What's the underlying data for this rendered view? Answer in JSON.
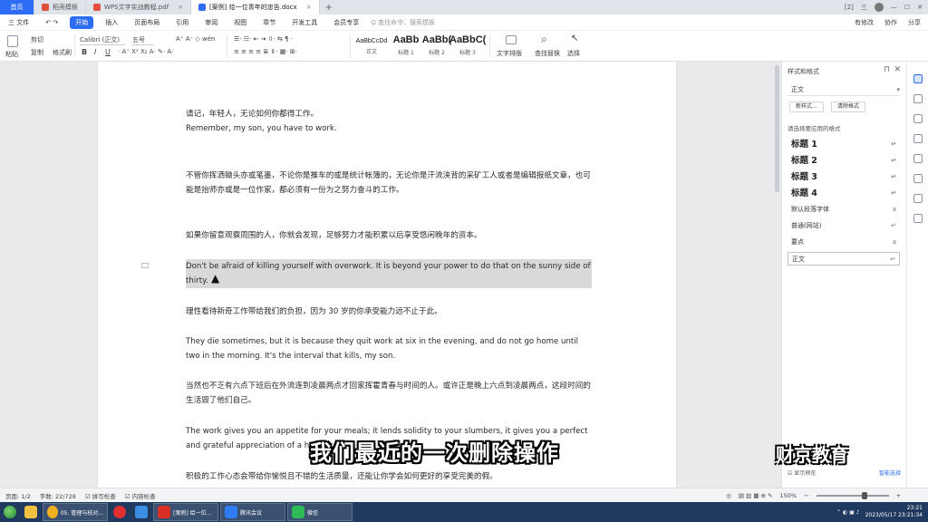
{
  "tabs": [
    {
      "label": "首页",
      "kind": "home"
    },
    {
      "label": "稻壳模板",
      "color": "#e0503c"
    },
    {
      "label": "WPS文字实战教程.pdf",
      "color": "#e0503c",
      "close": "×"
    },
    {
      "label": "[案例] 给一位青年的忠告.docx",
      "color": "#2d6df6",
      "close": "×",
      "active": true
    }
  ],
  "tab_plus": "+",
  "tab_right": {
    "num": "2",
    "badge": "三"
  },
  "menu": {
    "file": "三 文件",
    "items": [
      "开始",
      "插入",
      "页面布局",
      "引用",
      "审阅",
      "视图",
      "章节",
      "开发工具",
      "会员专享"
    ],
    "active": "开始",
    "search": "Q 查找命令、搜索模板",
    "right": [
      "有修改",
      "协作",
      "分享"
    ]
  },
  "ribbon": {
    "paste": "粘贴",
    "cut": "剪切",
    "copy": "复制",
    "format_painter": "格式刷",
    "font": "Calibri (正文)",
    "font_size": "五号",
    "bold": "B",
    "italic": "I",
    "underline": "U",
    "styles": [
      {
        "preview": "AaBbCcDd",
        "label": "正文"
      },
      {
        "preview": "AaBb",
        "label": "标题 1"
      },
      {
        "preview": "AaBb(",
        "label": "标题 2"
      },
      {
        "preview": "AaBbC(",
        "label": "标题 3"
      }
    ],
    "text_layout": "文字排版",
    "find_replace": "查找替换",
    "select": "选择"
  },
  "document": {
    "paragraphs": [
      "请记，年轻人，无论如何你都得工作。\nRemember, my son, you have to work.",
      "不管你挥洒锄头亦或笔墨，不论你是推车的或是统计帐簿的，无论你是汗流浃背的采矿工人或者是编辑报纸文章，也可能是抬师亦或是一位作家，都必须有一份为之努力奋斗的工作。",
      "如果你留意观察周围的人，你就会发现，足够努力才能积累以后享受悠闲晚年的资本。",
      "Don't be afraid of killing yourself with overwork. It is beyond your power to do that on the sunny side of thirty.",
      "理性看待新奇工作带给我们的负担，因为 30 岁的你承受能力远不止于此。",
      "They die sometimes, but it is because they quit work at six in the evening, and do not go home until two in the morning. It's the interval that kills, my son.",
      "当然也不乏有六点下班后在外流连到凌晨两点才回家挥霍青春与时间的人。或许正是晚上六点到凌晨两点，这段时间的生活毁了他们自己。",
      "The work gives you an appetite for your meals; it lends solidity to your slumbers, it gives you a perfect and grateful appreciation of a holiday.",
      "积极的工作心态会带给你愉悦且不错的生活质量，还能让你学会如何更好的享受完美的假。"
    ]
  },
  "panel": {
    "title": "样式和格式",
    "current_style": "正文",
    "new_style": "新样式...",
    "clear_format": "清除格式",
    "apply_label": "请选择要应用的格式",
    "styles": [
      {
        "label": "标题 1",
        "heading": true
      },
      {
        "label": "标题 2",
        "heading": true
      },
      {
        "label": "标题 3",
        "heading": true
      },
      {
        "label": "标题 4",
        "heading": true
      },
      {
        "label": "默认段落字体",
        "heading": false
      },
      {
        "label": "普通(网站)",
        "heading": false
      },
      {
        "label": "要点",
        "heading": false
      },
      {
        "label": "正文",
        "heading": false,
        "selected": true
      }
    ],
    "show_preview": "显示预览",
    "smart_select": "智能选择"
  },
  "status": {
    "page": "页面: 1/2",
    "words": "字数: 22/728",
    "spell": "拼写检查",
    "content_check": "内容检查",
    "zoom": "150%"
  },
  "taskbar": {
    "apps": [
      {
        "label": "",
        "color": "#f0c040"
      },
      {
        "label": "05. 管理与校对...",
        "color": "#f0b020"
      },
      {
        "label": "",
        "color": "#e03030"
      },
      {
        "label": "",
        "color": "#3a8de0"
      },
      {
        "label": "[案例] 给一位...",
        "color": "#d93025"
      },
      {
        "label": "腾讯会议",
        "color": "#2f7cf6"
      },
      {
        "label": "微信",
        "color": "#2dbb55"
      }
    ],
    "time": "23:21",
    "date": "2023/05/17 23:21:34"
  },
  "overlay": {
    "subtitle": "我们最近的一次删除操作",
    "watermark": "财京教育"
  }
}
